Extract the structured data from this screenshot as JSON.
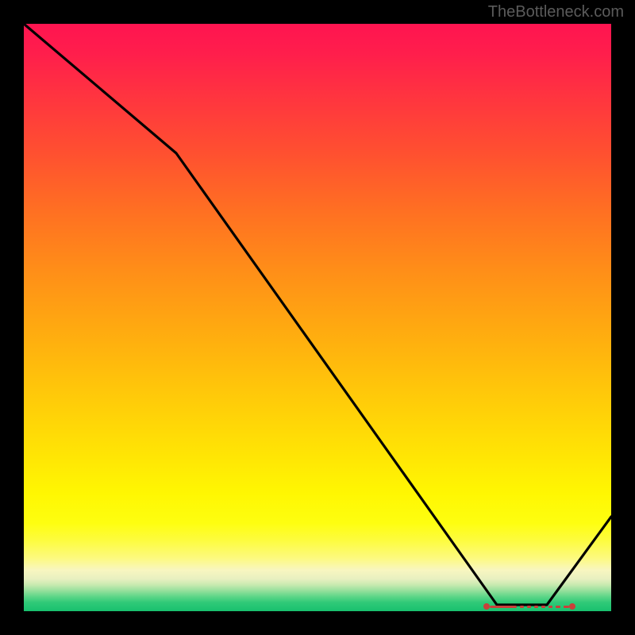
{
  "attribution": "TheBottleneck.com",
  "colors": {
    "page_bg": "#000000",
    "attribution_text": "#5b5b5b",
    "curve": "#000000",
    "marker": "#c9403a",
    "gradient_top": "#ff1450",
    "gradient_bottom": "#18c06e"
  },
  "chart_data": {
    "type": "line",
    "title": "",
    "xlabel": "",
    "ylabel": "",
    "xlim": [
      0,
      100
    ],
    "ylim": [
      0,
      100
    ],
    "grid": false,
    "legend": false,
    "series": [
      {
        "name": "curve",
        "x": [
          0,
          26,
          81,
          89,
          100
        ],
        "y": [
          100,
          78,
          1,
          1,
          16
        ],
        "note": "y estimated from vertical position on gradient; 100 = top, 0 = bottom"
      }
    ],
    "highlight_segment": {
      "x_start": 79,
      "x_end": 93,
      "y": 1,
      "style": "dashed-with-end-dots",
      "color": "#c9403a"
    }
  }
}
